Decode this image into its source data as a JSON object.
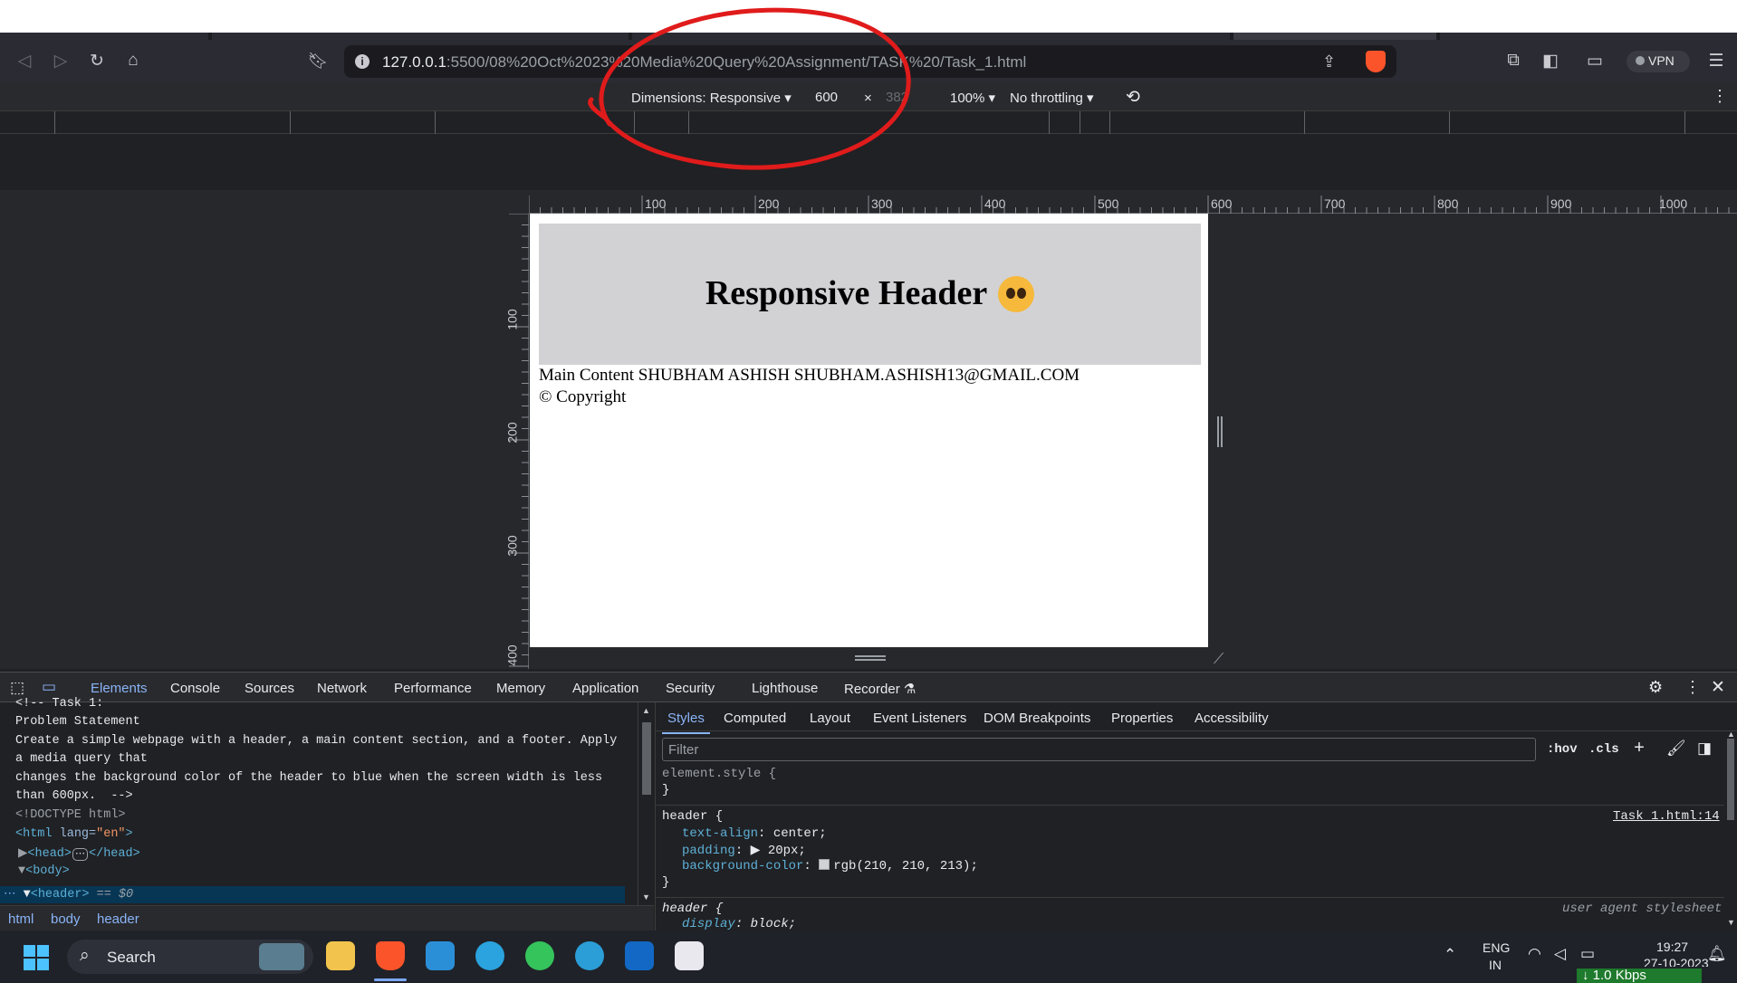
{
  "browser": {
    "url_host": "127.0.0.1",
    "url_path": ":5500/08%20Oct%2023%20Media%20Query%20Assignment/TASK%20/Task_1.html",
    "vpn_label": "VPN"
  },
  "device_toolbar": {
    "dimensions_label": "Dimensions: Responsive",
    "width_value": "600",
    "times": "×",
    "height_value": "382",
    "zoom_label": "100%",
    "throttling_label": "No throttling"
  },
  "rulers": {
    "horizontal": [
      "100",
      "200",
      "300",
      "400",
      "500",
      "600",
      "700",
      "800",
      "900",
      "1000"
    ],
    "vertical": [
      "100",
      "200",
      "300",
      "400"
    ]
  },
  "page": {
    "header_text": "Responsive Header",
    "main_text": "Main Content SHUBHAM ASHISH SHUBHAM.ASHISH13@GMAIL.COM",
    "footer_text": "© Copyright"
  },
  "devtools": {
    "tabs": [
      "Elements",
      "Console",
      "Sources",
      "Network",
      "Performance",
      "Memory",
      "Application",
      "Security",
      "Lighthouse",
      "Recorder"
    ],
    "active_tab": "Elements",
    "elements_lines": {
      "l0": "<!-- Task 1:",
      "l1": "Problem Statement",
      "l2": "Create a simple webpage with a header, a main content section, and a footer. Apply",
      "l3": "a media query that",
      "l4": "changes the background color of the header to blue when the screen width is less",
      "l5": "than 600px.  -->",
      "l6": "<!DOCTYPE html>",
      "l7_tag": "<html",
      "l7_attr": " lang=",
      "l7_val": "\"en\"",
      "l7_end": ">",
      "l8": "<head>",
      "l8_dots": "⋯",
      "l8_end": "</head>",
      "l9": "<body>",
      "l10_tag": "<header>",
      "l10_eq": " == $0"
    },
    "breadcrumb": [
      "html",
      "body",
      "header"
    ],
    "styles_tabs": [
      "Styles",
      "Computed",
      "Layout",
      "Event Listeners",
      "DOM Breakpoints",
      "Properties",
      "Accessibility"
    ],
    "filter_placeholder": "Filter",
    "hov": ":hov",
    "cls": ".cls",
    "rules": {
      "element_style": "element.style {",
      "close": "}",
      "header_sel": "header {",
      "header_src": "Task_1.html:14",
      "p1": "text-align",
      "v1": "center;",
      "p2": "padding",
      "v2": "20px;",
      "p3": "background-color",
      "v3": "rgb(210, 210, 213);",
      "ua_sel": "header {",
      "ua_src": "user agent stylesheet",
      "p4": "display",
      "v4": "block;"
    }
  },
  "taskbar": {
    "search_label": "Search",
    "lang_top": "ENG",
    "lang_bottom": "IN",
    "time": "19:27",
    "date": "27-10-2023",
    "speed": "1.0 Kbps"
  },
  "colors": {
    "header_bg": "#d2d2d5",
    "accent": "#8ab4f8",
    "annotation": "#e01b1b"
  }
}
